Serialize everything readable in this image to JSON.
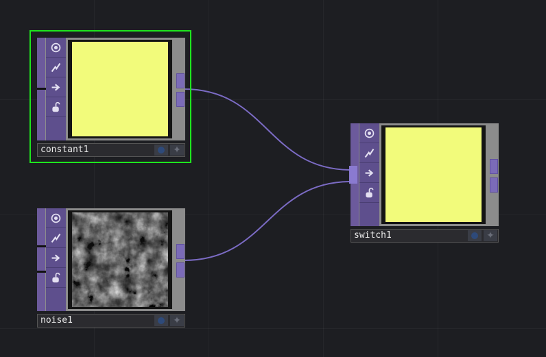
{
  "nodes": {
    "constant1": {
      "name": "constant1",
      "preview": "solid-yellow",
      "selected": true
    },
    "noise1": {
      "name": "noise1",
      "preview": "noise"
    },
    "switch1": {
      "name": "switch1",
      "preview": "solid-yellow"
    }
  },
  "icons": [
    "viewer-toggle-icon",
    "cook-flag-icon",
    "export-arrow-icon",
    "lock-icon"
  ],
  "colors": {
    "background": "#1d1e22",
    "operator_family": "#6c5a9c",
    "wire": "#7b6bc4",
    "preview_yellow": "#f2fb7b",
    "selection": "#1ee61e"
  },
  "connections": [
    {
      "from": "constant1",
      "to": "switch1"
    },
    {
      "from": "noise1",
      "to": "switch1"
    }
  ]
}
